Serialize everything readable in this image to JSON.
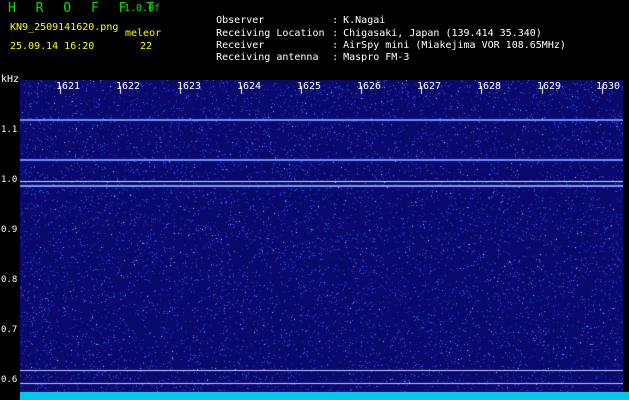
{
  "header": {
    "app_title": "H R O F F T",
    "version": "1.0.0f",
    "filename": "KN9_2509141620.png",
    "station_label": "meleor",
    "datetime": "25.09.14 16:20",
    "count": "22",
    "info": [
      {
        "label": "Observer",
        "value": "K.Nagai"
      },
      {
        "label": "Receiving Location",
        "value": "Chigasaki, Japan (139.414 35.340)"
      },
      {
        "label": "Receiver",
        "value": "AirSpy mini (Miakejima VOR 108.65MHz)"
      },
      {
        "label": "Receiving antenna",
        "value": "Maspro FM-3"
      }
    ]
  },
  "plot": {
    "y_unit": "kHz",
    "y_ticks": [
      "1.1",
      "1.0",
      "0.9",
      "0.8",
      "0.7",
      "0.6"
    ],
    "x_ticks": [
      "1621",
      "1622",
      "1623",
      "1624",
      "1625",
      "1626",
      "1627",
      "1628",
      "1629",
      "1630"
    ]
  },
  "colors": {
    "background": "#0a0a6e",
    "noise": "#3a5cff",
    "line": "#8fa8ff",
    "title_green": "#00e000",
    "meta_yellow": "#ffff00",
    "bottom_bar": "#00c8e8"
  }
}
